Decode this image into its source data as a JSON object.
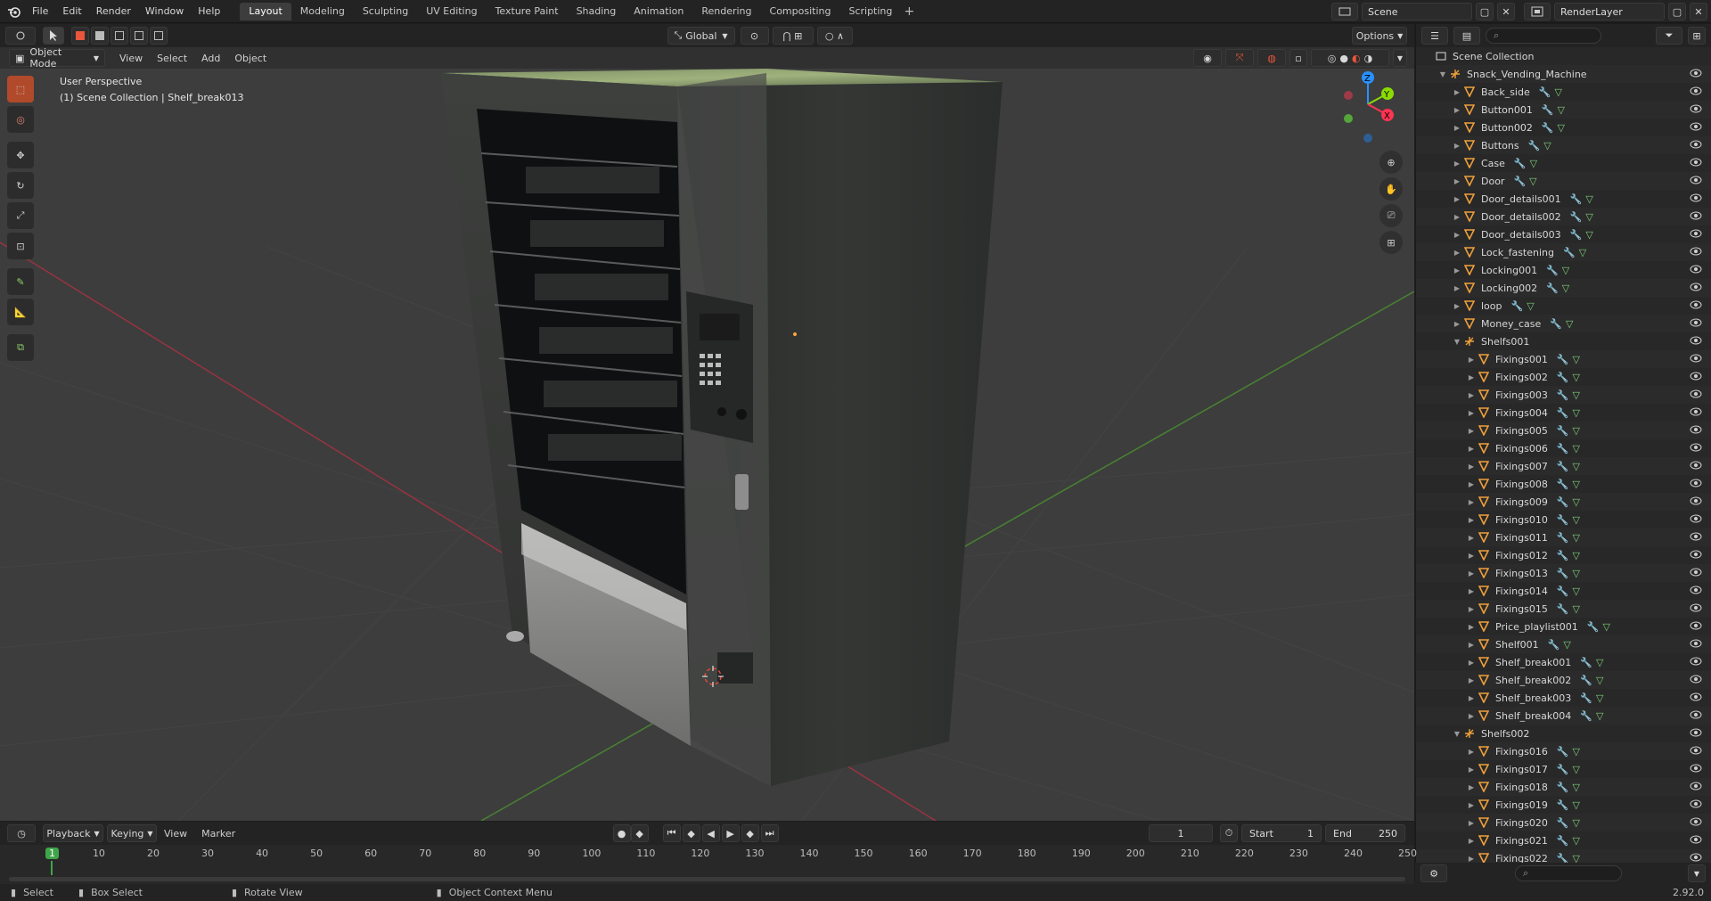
{
  "app": {
    "menu": [
      "File",
      "Edit",
      "Render",
      "Window",
      "Help"
    ],
    "workspaces": [
      "Layout",
      "Modeling",
      "Sculpting",
      "UV Editing",
      "Texture Paint",
      "Shading",
      "Animation",
      "Rendering",
      "Compositing",
      "Scripting"
    ],
    "active_workspace": "Layout",
    "scene": "Scene",
    "render_layer": "RenderLayer"
  },
  "viewport_header": {
    "mode": "Object Mode",
    "menus": [
      "View",
      "Select",
      "Add",
      "Object"
    ],
    "transform_orientation": "Global",
    "options_label": "Options"
  },
  "viewport": {
    "perspective_label": "User Perspective",
    "context_label": "(1) Scene Collection | Shelf_break013",
    "gizmo": {
      "x": "X",
      "y": "Y",
      "z": "Z"
    },
    "colors": {
      "x_axis": "#ff3352",
      "y_axis": "#8bdc00",
      "z_axis": "#2890ff",
      "background": "#3d3d3d"
    }
  },
  "toolbar": {
    "tools": [
      "select-box",
      "cursor",
      "move",
      "rotate",
      "scale",
      "transform",
      "annotate",
      "measure",
      "add-cube"
    ]
  },
  "outliner": {
    "root": "Scene Collection",
    "collection": "Snack_Vending_Machine",
    "objects_top": [
      "Back_side",
      "Button001",
      "Button002",
      "Buttons",
      "Case",
      "Door",
      "Door_details001",
      "Door_details002",
      "Door_details003",
      "Lock_fastening",
      "Locking001",
      "Locking002",
      "loop",
      "Money_case"
    ],
    "group1": "Shelfs001",
    "group1_children": [
      "Fixings001",
      "Fixings002",
      "Fixings003",
      "Fixings004",
      "Fixings005",
      "Fixings006",
      "Fixings007",
      "Fixings008",
      "Fixings009",
      "Fixings010",
      "Fixings011",
      "Fixings012",
      "Fixings013",
      "Fixings014",
      "Fixings015",
      "Price_playlist001",
      "Shelf001",
      "Shelf_break001",
      "Shelf_break002",
      "Shelf_break003",
      "Shelf_break004"
    ],
    "group2": "Shelfs002",
    "group2_children": [
      "Fixings016",
      "Fixings017",
      "Fixings018",
      "Fixings019",
      "Fixings020",
      "Fixings021",
      "Fixings022"
    ]
  },
  "timeline_header": {
    "menus": [
      "Playback",
      "Keying",
      "View",
      "Marker"
    ],
    "current_frame": "1",
    "start_label": "Start",
    "start": "1",
    "end_label": "End",
    "end": "250"
  },
  "timeline": {
    "ticks": [
      "1",
      "10",
      "20",
      "30",
      "40",
      "50",
      "60",
      "70",
      "80",
      "90",
      "100",
      "110",
      "120",
      "130",
      "140",
      "150",
      "160",
      "170",
      "180",
      "190",
      "200",
      "210",
      "220",
      "230",
      "240",
      "250"
    ]
  },
  "statusbar": {
    "items": [
      "Select",
      "Box Select",
      "Rotate View",
      "Object Context Menu"
    ],
    "version": "2.92.0"
  }
}
